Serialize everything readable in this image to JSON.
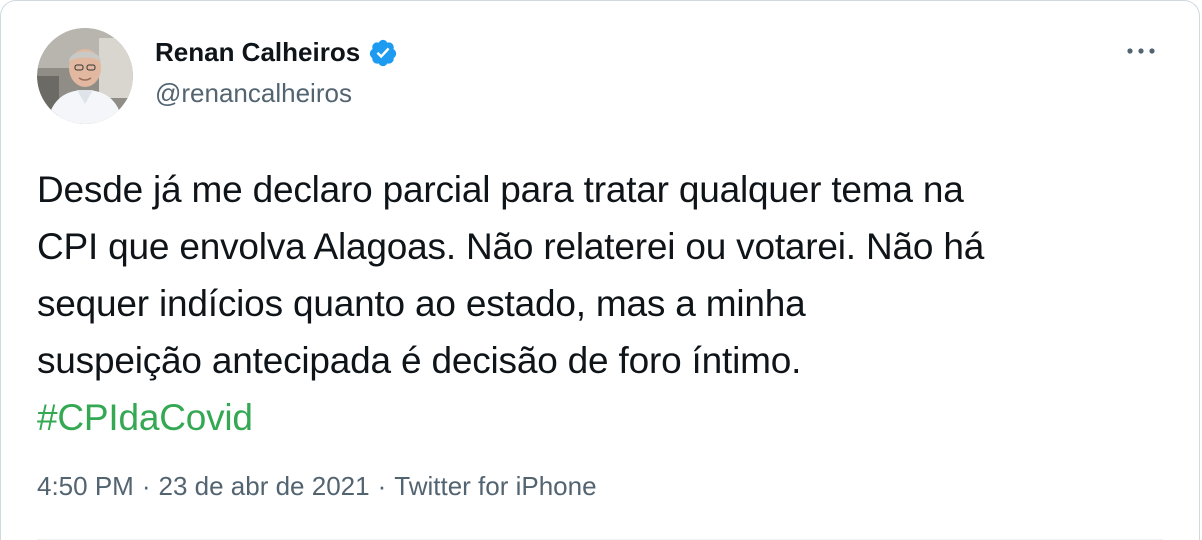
{
  "author": {
    "name": "Renan Calheiros",
    "handle": "@renancalheiros",
    "verified_icon": "verified-badge-icon",
    "avatar_icon": "profile-photo"
  },
  "tweet": {
    "lines": [
      "Desde já me declaro parcial para tratar qualquer tema na",
      "CPI que envolva Alagoas. Não relaterei ou votarei. Não há",
      "sequer indícios quanto ao estado, mas a minha",
      "suspeição antecipada é decisão de foro íntimo."
    ],
    "hashtag": "#CPIdaCovid"
  },
  "meta": {
    "time": "4:50 PM",
    "separator": "·",
    "date": "23 de abr de 2021",
    "source": "Twitter for iPhone"
  },
  "colors": {
    "text": "#0f1419",
    "secondary": "#536471",
    "hashtag": "#34a853",
    "verified": "#1d9bf0",
    "border": "#cfd9de"
  },
  "more_icon": "more-horizontal-icon"
}
